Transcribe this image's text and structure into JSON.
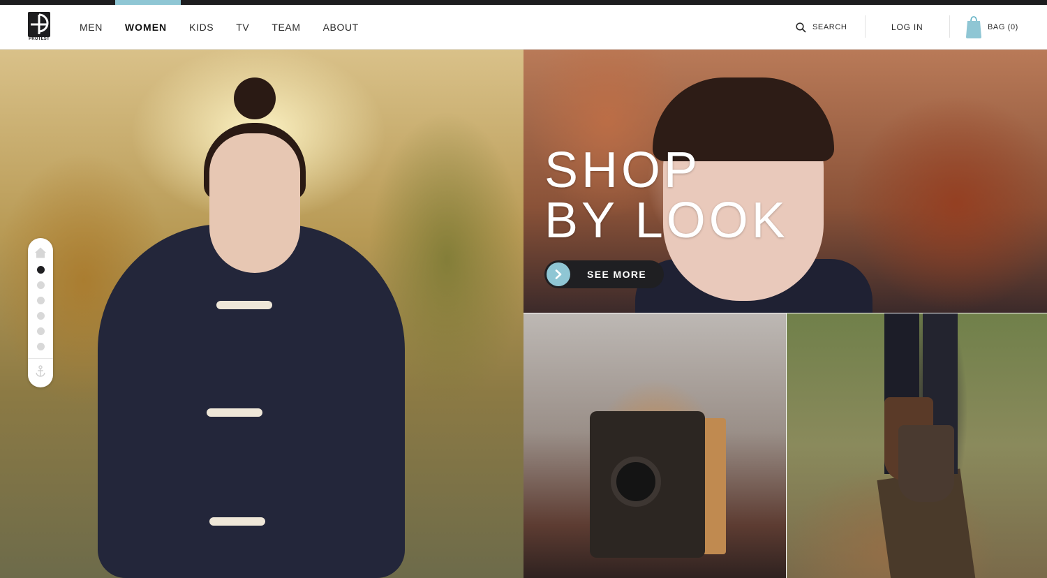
{
  "brand": {
    "logo_text": "PROTEST"
  },
  "nav": {
    "items": [
      {
        "label": "MEN",
        "active": false
      },
      {
        "label": "WOMEN",
        "active": true
      },
      {
        "label": "KIDS",
        "active": false
      },
      {
        "label": "TV",
        "active": false
      },
      {
        "label": "TEAM",
        "active": false
      },
      {
        "label": "ABOUT",
        "active": false
      }
    ]
  },
  "header_actions": {
    "search_label": "SEARCH",
    "search_icon": "search-icon",
    "login_label": "LOG IN",
    "bag_label": "BAG (0)",
    "bag_icon": "shopping-bag-icon"
  },
  "hero": {
    "title_line1": "SHOP",
    "title_line2": "BY LOOK",
    "cta_label": "SEE MORE",
    "cta_icon": "chevron-right-icon"
  },
  "side_navigator": {
    "home_icon": "home-icon",
    "anchor_icon": "anchor-icon",
    "dot_count": 6,
    "active_dot": 0
  },
  "colors": {
    "accent": "#8fc6d4",
    "dark": "#1f1f22",
    "text": "#2b2b2b"
  }
}
